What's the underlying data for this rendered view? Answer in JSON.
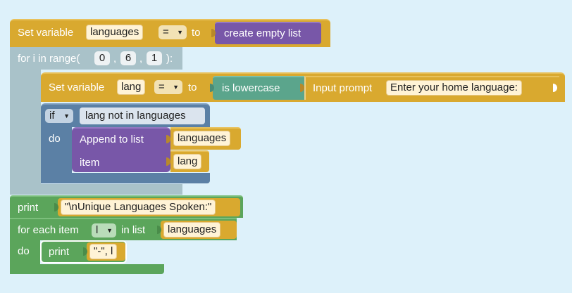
{
  "set_languages": {
    "label": "Set variable",
    "var_name": "languages",
    "op": "=",
    "to_label": "to",
    "value": "create empty list"
  },
  "for_loop": {
    "label": "for i in range(",
    "start": "0",
    "stop": "6",
    "step": "1",
    "comma": ",",
    "close": "):"
  },
  "set_lang": {
    "label": "Set variable",
    "var_name": "lang",
    "op": "=",
    "to_label": "to",
    "func": "is lowercase",
    "input_label": "Input prompt",
    "prompt_text": "Enter your home language:"
  },
  "if_block": {
    "if_label": "if",
    "condition": "lang not in languages",
    "do_label": "do"
  },
  "append_block": {
    "label": "Append to list",
    "list_name": "languages",
    "item_label": "item",
    "item_value": "lang"
  },
  "print_header": {
    "label": "print",
    "text": "\"\\nUnique Languages Spoken:\""
  },
  "for_each": {
    "label": "for each item",
    "var_name": "l",
    "in_list_label": "in list",
    "list_name": "languages",
    "do_label": "do"
  },
  "print_item": {
    "label": "print",
    "args": "\"-\", l"
  },
  "colors": {
    "workspace": "#ddf1fa",
    "variables": "#d9a92f",
    "loops": "#a9c2c9",
    "logic": "#5b80a5",
    "lists": "#7857a8",
    "text": "#5ba58c",
    "output": "#5ba55b"
  }
}
